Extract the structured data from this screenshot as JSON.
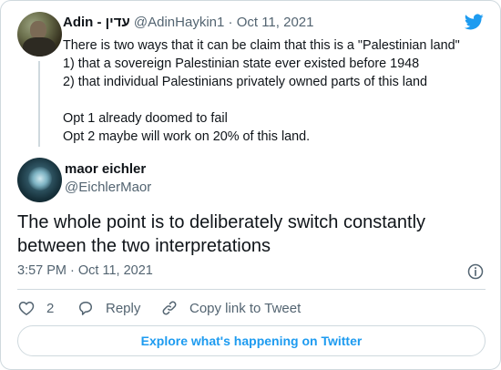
{
  "colors": {
    "twitter_blue": "#1d9bf0",
    "text_primary": "#0f1419",
    "text_secondary": "#536471",
    "border": "#cfd9de"
  },
  "icons": {
    "brand": "twitter-bird-icon",
    "info": "info-circle-icon",
    "like": "heart-outline-icon",
    "reply": "speech-bubble-icon",
    "copy": "link-chain-icon"
  },
  "quoted": {
    "author_name": "Adin - עדין",
    "handle": "@AdinHaykin1",
    "separator": "·",
    "date": "Oct 11, 2021",
    "lines": [
      "There is two ways that it can be claim that this is a \"Palestinian land\"",
      "1) that a sovereign Palestinian state ever existed before 1948",
      "2) that individual Palestinians privately owned parts of this land",
      "",
      "Opt 1 already doomed to fail",
      "Opt 2 maybe will work on 20% of this land."
    ]
  },
  "tweet": {
    "author_name": "maor eichler",
    "handle": "@EichlerMaor",
    "text": "The whole point is to deliberately switch constantly between the two interpretations",
    "timestamp": "3:57 PM · Oct 11, 2021"
  },
  "actions": {
    "like_count": "2",
    "reply_label": "Reply",
    "copy_label": "Copy link to Tweet"
  },
  "footer": {
    "explore_label": "Explore what's happening on Twitter"
  }
}
